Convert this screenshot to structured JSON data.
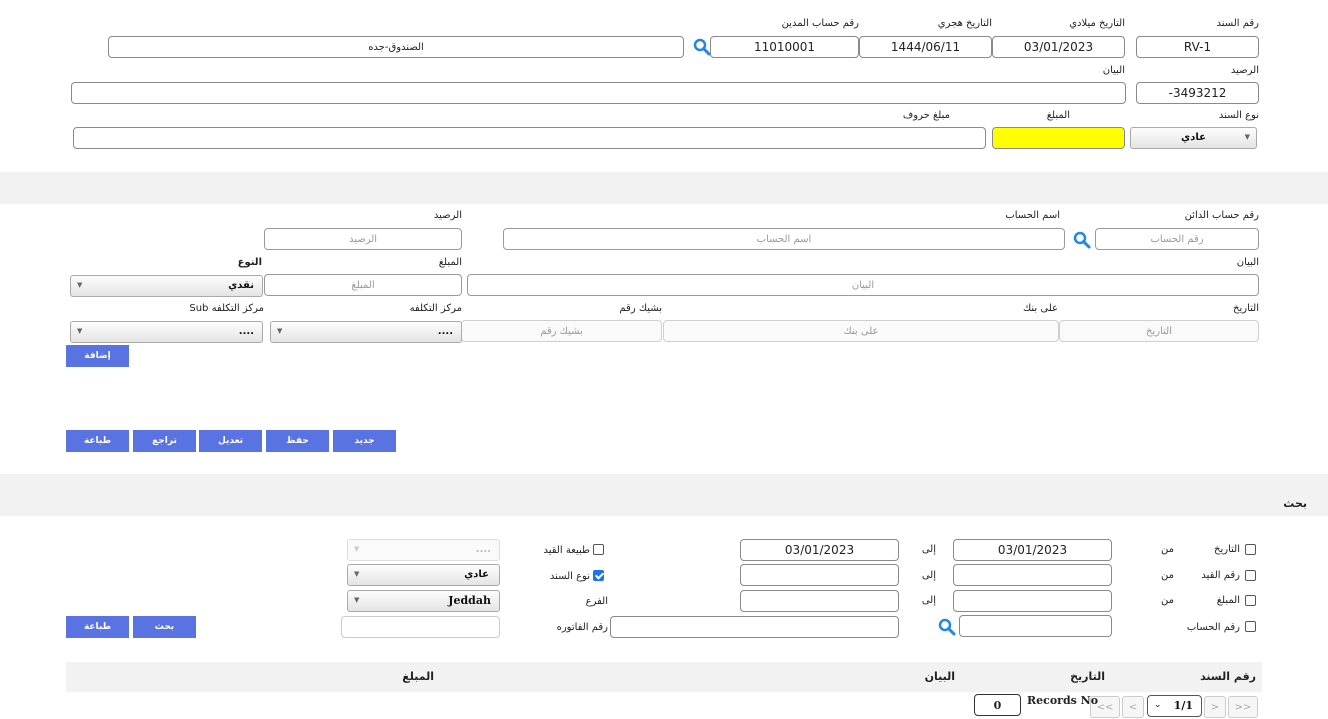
{
  "voucher": {
    "labels": {
      "doc_no": "رقم السند",
      "greg_date": "التاريخ ميلادي",
      "hijri_date": "التاريخ هجري",
      "debit_account_no": "رقم حساب المدين",
      "balance": "الرصيد",
      "description": "البيان",
      "doc_type": "نوع السند",
      "amount": "المبلغ",
      "amount_words": "مبلغ حروف"
    },
    "values": {
      "doc_no": "RV-1",
      "greg_date": "03/01/2023",
      "hijri_date": "1444/06/11",
      "debit_account_no": "11010001",
      "account_name": "الصندوق-جده",
      "balance": "3493212-",
      "description": "",
      "doc_type": "عادي",
      "amount": "",
      "amount_words": ""
    },
    "highlight_color": "#ffff00"
  },
  "line_entry": {
    "labels": {
      "credit_account_no": "رقم حساب الدائن",
      "account_name": "اسم الحساب",
      "balance": "الرصيد",
      "description": "البيان",
      "amount": "المبلغ",
      "type": "النوع",
      "date": "التاريخ",
      "on_bank": "على بنك",
      "cheque_no": "بشيك رقم",
      "cost_center": "مركز التكلفه",
      "sub_cost_center": "مركز التكلفه Sub"
    },
    "placeholders": {
      "credit_account_no": "رقم الحساب",
      "account_name": "اسم الحساب",
      "balance": "الرصيد",
      "description": "البيان",
      "amount": "المبلغ",
      "date": "التاريخ",
      "on_bank": "على بنك",
      "cheque_no": "بشيك رقم"
    },
    "values": {
      "type": "نقدي",
      "cost_center": "....",
      "sub_cost_center": "...."
    },
    "add_label": "إضافة"
  },
  "actions": {
    "new": "جديد",
    "save": "حفظ",
    "edit": "تعديل",
    "undo": "تراجع",
    "print": "طباعة"
  },
  "search": {
    "title": "بحث",
    "labels": {
      "date": "التاريخ",
      "entry_no": "رقم القيد",
      "amount": "المبلغ",
      "account_no": "رقم الحساب",
      "from": "من",
      "to": "إلى",
      "entry_nature": "طبيعة القيد",
      "doc_type": "نوع السند",
      "branch": "الفرع",
      "invoice_no": "رقم الفاتوره"
    },
    "values": {
      "date_from": "03/01/2023",
      "date_to": "03/01/2023",
      "entry_nature": "....",
      "doc_type": "عادي",
      "branch": "Jeddah"
    },
    "search_label": "بحث",
    "print_label": "طباعة"
  },
  "results": {
    "columns": [
      "رقم السند",
      "التاريخ",
      "البيان",
      "المبلغ"
    ],
    "pager": {
      "first": "<<",
      "prev": "<",
      "page": "1/1",
      "next": ">",
      "last": ">>",
      "records_label": "Records No",
      "records_count": "0"
    }
  },
  "colors": {
    "button": "#5a73e3",
    "band": "#f2f2f2",
    "icon": "#1e88e5"
  }
}
